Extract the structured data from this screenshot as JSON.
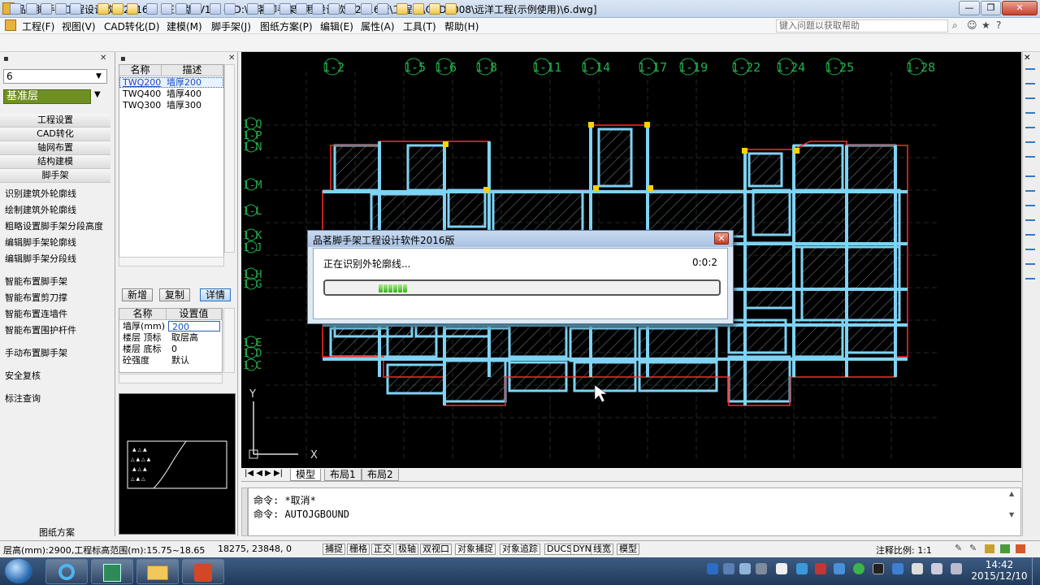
{
  "window": {
    "title": "品茗脚手架工程设计软件2016版 (正式版)V1.0 - [D:\\品茗脚手架工程设计软件2016版\\工程库\\CAD2008\\远洋工程(示例使用)\\6.dwg]",
    "min": "—",
    "max": "❐",
    "close": "✕"
  },
  "menu": {
    "items": [
      "工程(F)",
      "视图(V)",
      "CAD转化(D)",
      "建模(M)",
      "脚手架(J)",
      "图纸方案(P)",
      "编辑(E)",
      "属性(A)",
      "工具(T)",
      "帮助(H)"
    ],
    "help_placeholder": "键入问题以获取帮助"
  },
  "left": {
    "floor_value": "6",
    "layer": "基准层",
    "sections": [
      "工程设置",
      "CAD转化",
      "轴网布置",
      "结构建模",
      "脚手架"
    ],
    "group1": [
      "识别建筑外轮廓线",
      "绘制建筑外轮廓线",
      "粗略设置脚手架分段高度",
      "编辑脚手架轮廓线",
      "编辑脚手架分段线"
    ],
    "group2": [
      "智能布置脚手架",
      "智能布置剪刀撑",
      "智能布置连墙件",
      "智能布置围护杆件"
    ],
    "manual": "手动布置脚手架",
    "check": "安全复核",
    "query": "标注查询",
    "drawing_plan": "图纸方案"
  },
  "components": {
    "header_name": "名称",
    "header_desc": "描述",
    "rows": [
      {
        "name": "TWQ200",
        "desc": "墙厚200"
      },
      {
        "name": "TWQ400",
        "desc": "墙厚400"
      },
      {
        "name": "TWQ300",
        "desc": "墙厚300"
      }
    ],
    "btn_new": "新增",
    "btn_copy": "复制",
    "btn_detail": "详情"
  },
  "props": {
    "header_name": "名称",
    "header_value": "设置值",
    "rows": [
      {
        "name": "墙厚(mm)",
        "value": "200"
      },
      {
        "name": "楼层 顶标",
        "value": "取层高"
      },
      {
        "name": "楼层 底标",
        "value": "0"
      },
      {
        "name": "砼强度",
        "value": "默认"
      }
    ]
  },
  "canvas": {
    "axis_top": [
      "1-2",
      "1-5",
      "1-6",
      "1-8",
      "1-11",
      "1-14",
      "1-17",
      "1-19",
      "1-22",
      "1-24",
      "1-25",
      "1-28"
    ],
    "axis_left": [
      "1-Q",
      "1-P",
      "1-N",
      "1-M",
      "1-L",
      "1-K",
      "1-J",
      "1-H",
      "1-G",
      "1-E",
      "1-D",
      "1-C"
    ],
    "ucs_x": "X",
    "ucs_y": "Y"
  },
  "tabs": [
    "模型",
    "布局1",
    "布局2"
  ],
  "command": {
    "lines": [
      "命令: *取消*",
      "命令: AUTOJGBOUND"
    ]
  },
  "dialog": {
    "title": "品茗脚手架工程设计软件2016版",
    "message": "正在识别外轮廓线...",
    "time": "0:0:2",
    "progress": 0.08
  },
  "status": {
    "floor_info": "层高(mm):2900,工程标高范围(m):15.75~18.65",
    "coords": "18275, 23848, 0",
    "toggles": [
      "捕捉",
      "栅格",
      "正交",
      "极轴",
      "双视口",
      "对象捕捉",
      "对象追踪",
      "DUCS",
      "DYN",
      "线宽",
      "模型"
    ],
    "scale": "注释比例: 1:1"
  },
  "taskbar": {
    "time": "14:42",
    "date": "2015/12/10"
  },
  "colors": {
    "structure": "#7fd3f4",
    "axis": "#22b14c",
    "redline": "#ff2a2a",
    "layer_bg": "#6f8f22"
  }
}
